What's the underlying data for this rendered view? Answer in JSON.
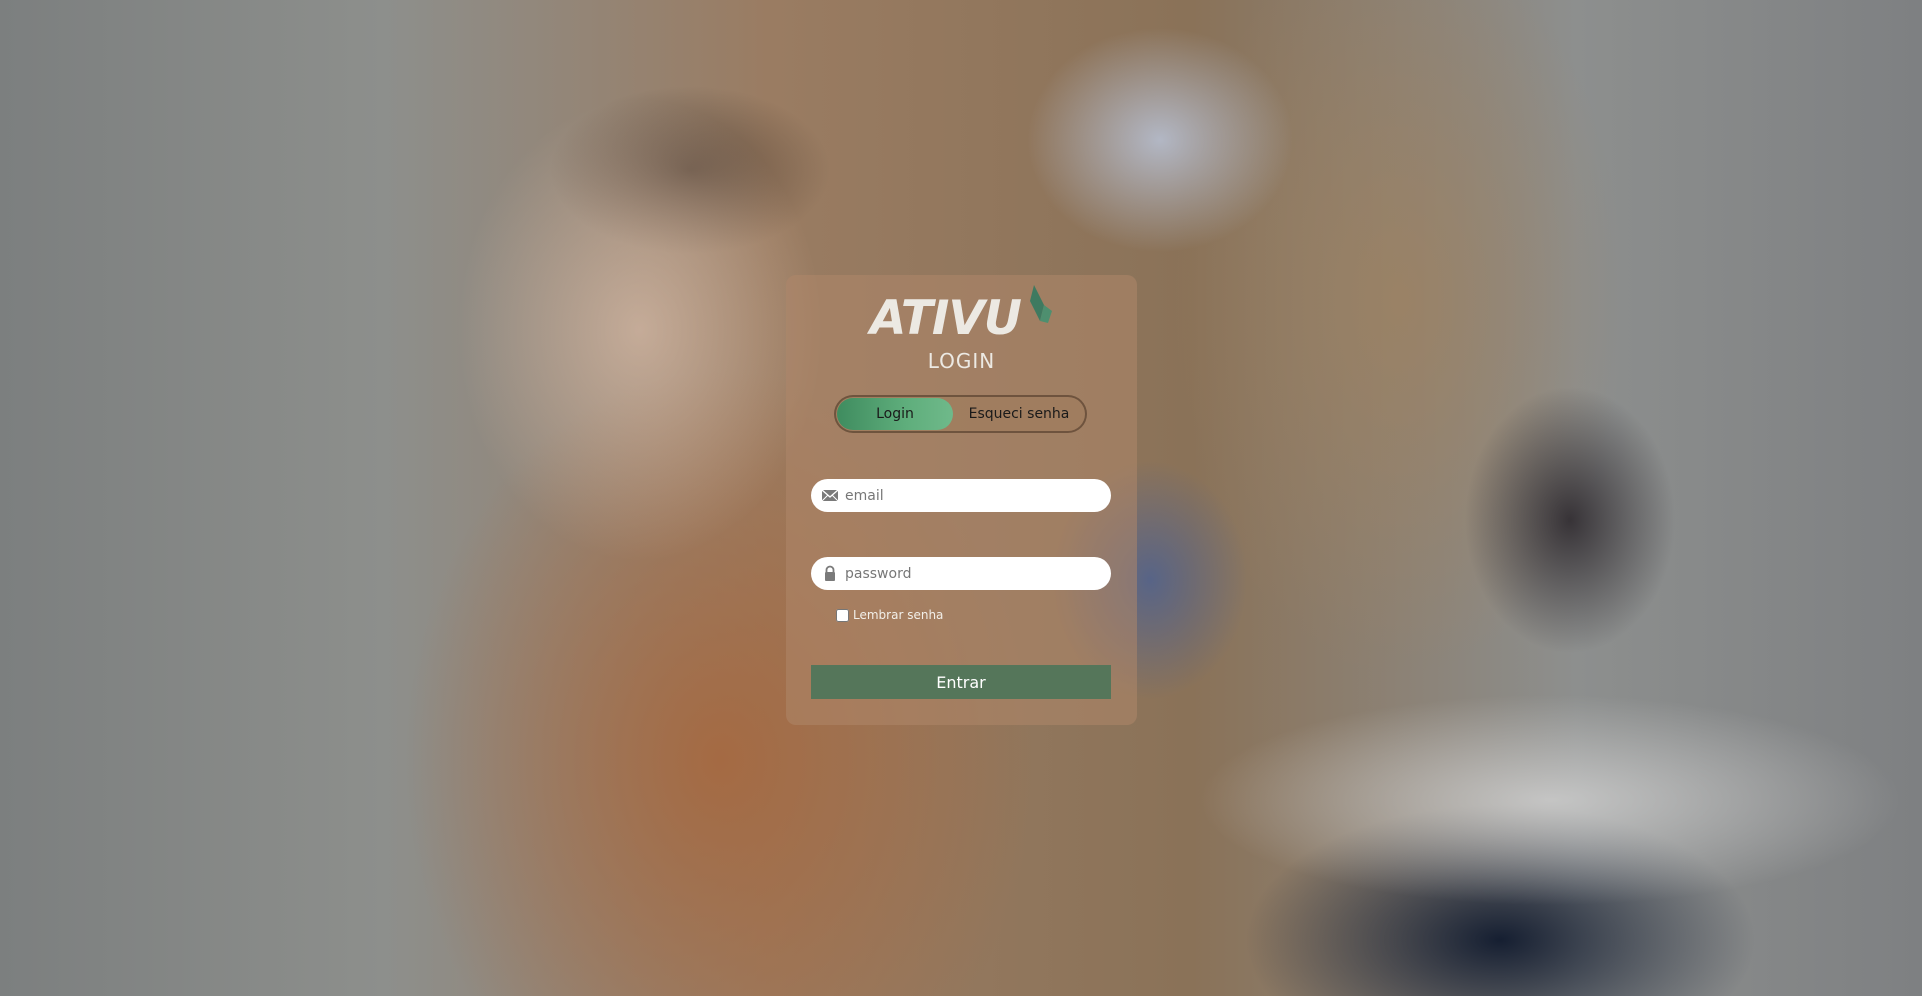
{
  "logo": {
    "text": "ATIVU",
    "mark_color": "#3f7a60"
  },
  "page_title": "LOGIN",
  "tabs": [
    {
      "label": "Login",
      "active": true
    },
    {
      "label": "Esqueci senha",
      "active": false
    }
  ],
  "form": {
    "email": {
      "value": "",
      "placeholder": "email",
      "icon": "envelope-icon"
    },
    "password": {
      "value": "",
      "placeholder": "password",
      "icon": "lock-icon"
    },
    "remember": {
      "label": "Lembrar senha",
      "checked": false
    },
    "submit_label": "Entrar"
  },
  "colors": {
    "accent": "#5fae7c",
    "submit": "#55765a"
  }
}
